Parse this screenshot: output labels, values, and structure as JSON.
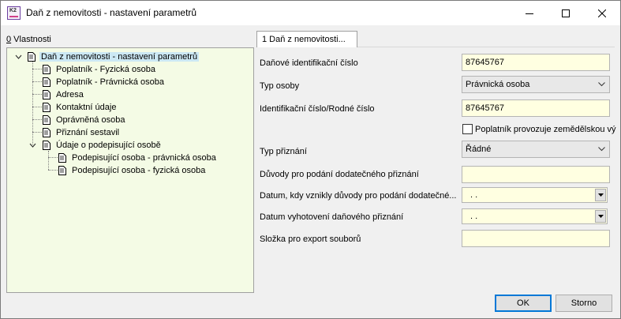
{
  "window": {
    "title": "Daň z nemovitosti - nastavení parametrů",
    "app_icon_text": "K2",
    "controls": {
      "minimize": "minimize-icon",
      "maximize": "maximize-icon",
      "close": "close-icon"
    }
  },
  "left_panel": {
    "label_prefix": "0",
    "label_text": " Vlastnosti",
    "tree": {
      "root": "Daň z nemovitosti - nastavení parametrů",
      "items": [
        "Poplatník - Fyzická osoba",
        "Poplatník - Právnická osoba",
        "Adresa",
        "Kontaktní údaje",
        "Oprávněná osoba",
        "Přiznání sestavil",
        "Údaje o podepisující osobě"
      ],
      "subitems": [
        "Podepisující osoba - právnická osoba",
        "Podepisující osoba - fyzická osoba"
      ]
    }
  },
  "tab": {
    "label": "1 Daň z nemovitosti..."
  },
  "form": {
    "dic": {
      "label": "Daňové identifikační číslo",
      "value": "87645767"
    },
    "typ_osoby": {
      "label": "Typ osoby",
      "value": "Právnická osoba"
    },
    "ico": {
      "label": "Identifikační číslo/Rodné číslo",
      "value": "87645767"
    },
    "zemedelska": {
      "label": "Poplatník provozuje zemědělskou vý",
      "checked": false
    },
    "typ_priznani": {
      "label": "Typ přiznání",
      "value": "Řádné"
    },
    "duvody": {
      "label": "Důvody pro podání dodatečného přiznání",
      "value": ""
    },
    "datum_duvody": {
      "label": "Datum, kdy vznikly důvody pro podání dodatečné...",
      "value": ". ."
    },
    "datum_vyhotoveni": {
      "label": "Datum vyhotovení daňového přiznání",
      "value": ". ."
    },
    "slozka": {
      "label": "Složka pro export souborů",
      "value": ""
    }
  },
  "buttons": {
    "ok": "OK",
    "cancel": "Storno"
  }
}
